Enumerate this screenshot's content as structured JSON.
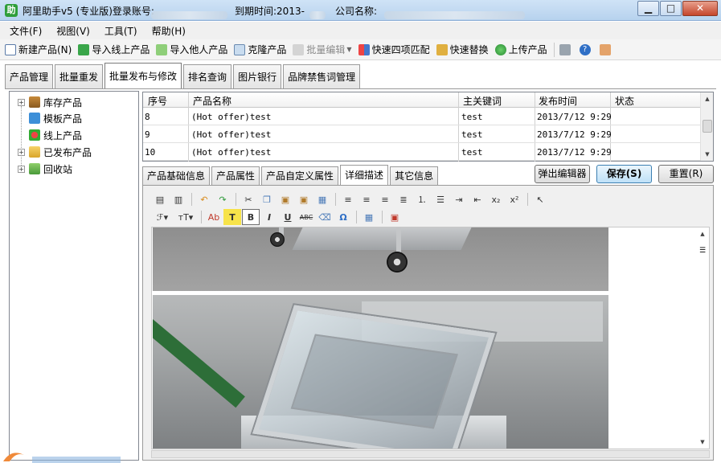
{
  "window": {
    "app_icon_text": "助",
    "title_prefix": "阿里助手v5 (专业版)登录账号:",
    "expire_label": "到期时间:2013-",
    "company_label": "公司名称:",
    "minimize_glyph": "▁",
    "maximize_glyph": "□",
    "close_glyph": "✕"
  },
  "menu": [
    "文件(F)",
    "视图(V)",
    "工具(T)",
    "帮助(H)"
  ],
  "toolbar": {
    "new_product": "新建产品(N)",
    "import_online": "导入线上产品",
    "import_others": "导入他人产品",
    "clone": "克隆产品",
    "batch_edit": "批量编辑",
    "match_four": "快速四项匹配",
    "quick_replace": "快速替换",
    "upload": "上传产品"
  },
  "main_tabs": [
    "产品管理",
    "批量重发",
    "批量发布与修改",
    "排名查询",
    "图片银行",
    "品牌禁售词管理"
  ],
  "tree": {
    "items": [
      {
        "label": "库存产品",
        "expander": "+"
      },
      {
        "label": "模板产品",
        "expander": ""
      },
      {
        "label": "线上产品",
        "expander": ""
      },
      {
        "label": "已发布产品",
        "expander": "+"
      },
      {
        "label": "回收站",
        "expander": "+"
      }
    ]
  },
  "grid": {
    "headers": [
      "序号",
      "产品名称",
      "主关键词",
      "发布时间",
      "状态"
    ],
    "rows": [
      {
        "no": "8",
        "name": "(Hot offer)test",
        "keyword": "test",
        "time": "2013/7/12 9:29",
        "status": ""
      },
      {
        "no": "9",
        "name": "(Hot offer)test",
        "keyword": "test",
        "time": "2013/7/12 9:29",
        "status": ""
      },
      {
        "no": "10",
        "name": "(Hot offer)test",
        "keyword": "test",
        "time": "2013/7/12 9:29",
        "status": ""
      }
    ]
  },
  "sub_tabs": [
    "产品基础信息",
    "产品属性",
    "产品自定义属性",
    "详细描述",
    "其它信息"
  ],
  "buttons": {
    "popup_editor": "弹出编辑器",
    "save": "保存(S)",
    "reset": "重置(R)"
  },
  "editor": {
    "font_btn": "ℱ",
    "size_btn": "тT",
    "color_btn": "Ab",
    "highlight_btn": "T",
    "bold_btn": "B",
    "italic_btn": "I",
    "underline_btn": "U",
    "strike_btn": "ABC",
    "omega_btn": "Ω",
    "sub_btn": "x₂",
    "sup_btn": "x²"
  },
  "colors": {
    "title_bar": "#c4dbf2",
    "accent_green": "#2f9e3a",
    "close_red": "#c5462c",
    "save_blue": "#3c7fb1"
  }
}
